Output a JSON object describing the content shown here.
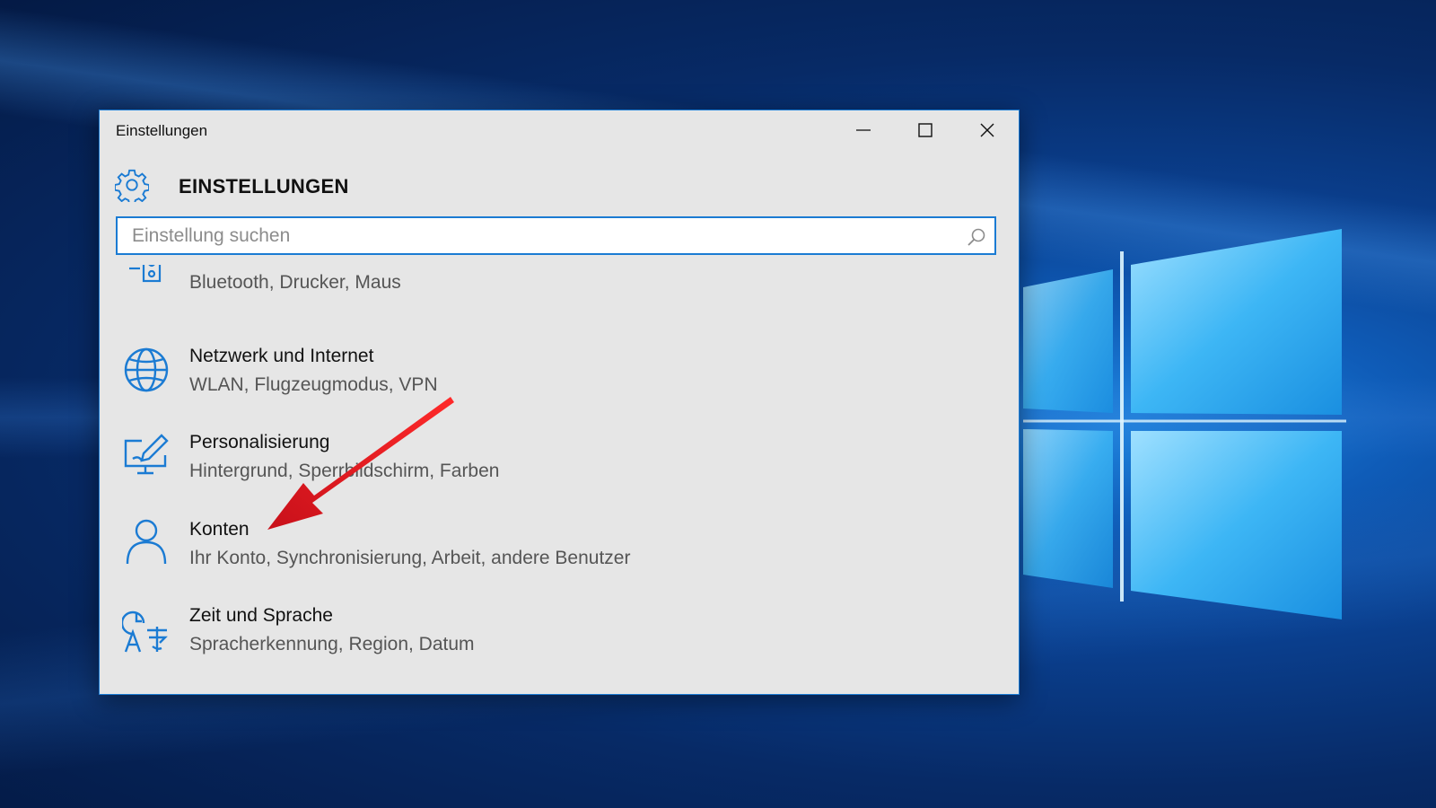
{
  "window": {
    "title": "Einstellungen",
    "controls": {
      "minimize": "minimize",
      "maximize": "maximize",
      "close": "close"
    }
  },
  "header": {
    "title": "EINSTELLUNGEN"
  },
  "search": {
    "placeholder": "Einstellung suchen",
    "value": ""
  },
  "items": [
    {
      "title": "",
      "subtitle": "Bluetooth, Drucker, Maus",
      "icon": "devices-icon"
    },
    {
      "title": "Netzwerk und Internet",
      "subtitle": "WLAN, Flugzeugmodus, VPN",
      "icon": "globe-icon"
    },
    {
      "title": "Personalisierung",
      "subtitle": "Hintergrund, Sperrbildschirm, Farben",
      "icon": "personalization-icon"
    },
    {
      "title": "Konten",
      "subtitle": "Ihr Konto, Synchronisierung, Arbeit, andere Benutzer",
      "icon": "user-icon"
    },
    {
      "title": "Zeit und Sprache",
      "subtitle": "Spracherkennung, Region, Datum",
      "icon": "time-language-icon"
    }
  ],
  "colors": {
    "accent": "#1b7bd3",
    "window_bg": "#e6e6e6",
    "annotation_arrow": "#e0151c"
  }
}
